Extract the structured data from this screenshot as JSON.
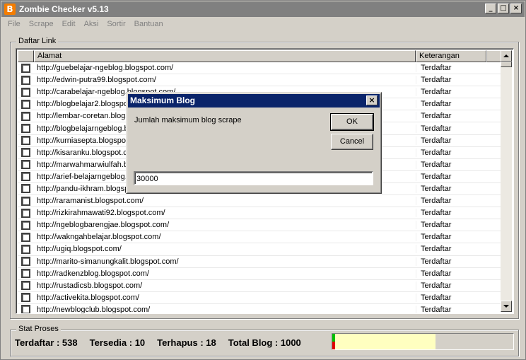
{
  "window": {
    "title": "Zombie Checker v5.13",
    "icon": "B"
  },
  "winbtns": [
    "_",
    "□",
    "×"
  ],
  "menu": [
    "File",
    "Scrape",
    "Edit",
    "Aksi",
    "Sortir",
    "Bantuan"
  ],
  "daftar": {
    "group_label": "Daftar Link",
    "columns": [
      "Alamat",
      "Keterangan"
    ],
    "rows": [
      {
        "url": "http://guebelajar-ngeblog.blogspot.com/",
        "ket": "Terdaftar"
      },
      {
        "url": "http://edwin-putra99.blogspot.com/",
        "ket": "Terdaftar"
      },
      {
        "url": "http://carabelajar-ngeblog.blogspot.com/",
        "ket": "Terdaftar"
      },
      {
        "url": "http://blogbelajar2.blogspot.com/",
        "ket": "Terdaftar"
      },
      {
        "url": "http://lembar-coretan.blogspot.com/",
        "ket": "Terdaftar"
      },
      {
        "url": "http://blogbelajarngeblog.blogspot.com/",
        "ket": "Terdaftar"
      },
      {
        "url": "http://kurniasepta.blogspot.com/",
        "ket": "Terdaftar"
      },
      {
        "url": "http://kisaranku.blogspot.com/",
        "ket": "Terdaftar"
      },
      {
        "url": "http://marwahmarwiulfah.blogspot.com/",
        "ket": "Terdaftar"
      },
      {
        "url": "http://arief-belajarngeblog.blogspot.com/",
        "ket": "Terdaftar"
      },
      {
        "url": "http://pandu-ikhram.blogspot.com/",
        "ket": "Terdaftar"
      },
      {
        "url": "http://raramanist.blogspot.com/",
        "ket": "Terdaftar"
      },
      {
        "url": "http://rizkirahmawati92.blogspot.com/",
        "ket": "Terdaftar"
      },
      {
        "url": "http://ngeblogbarengjae.blogspot.com/",
        "ket": "Terdaftar"
      },
      {
        "url": "http://wakngahbelajar.blogspot.com/",
        "ket": "Terdaftar"
      },
      {
        "url": "http://ugiq.blogspot.com/",
        "ket": "Terdaftar"
      },
      {
        "url": "http://marito-simanungkalit.blogspot.com/",
        "ket": "Terdaftar"
      },
      {
        "url": "http://radkenzblog.blogspot.com/",
        "ket": "Terdaftar"
      },
      {
        "url": "http://rustadicsb.blogspot.com/",
        "ket": "Terdaftar"
      },
      {
        "url": "http://activekita.blogspot.com/",
        "ket": "Terdaftar"
      },
      {
        "url": "http://newblogclub.blogspot.com/",
        "ket": "Terdaftar"
      }
    ]
  },
  "stat": {
    "group_label": "Stat Proses",
    "terdaftar": "Terdaftar : 538",
    "tersedia": "Tersedia : 10",
    "terhapus": "Terhapus : 18",
    "total": "Total Blog : 1000",
    "progress_fraction": 0.57
  },
  "dialog": {
    "title": "Maksimum Blog",
    "close": "×",
    "prompt": "Jumlah maksimum blog scrape",
    "ok": "OK",
    "cancel": "Cancel",
    "value": "30000"
  }
}
